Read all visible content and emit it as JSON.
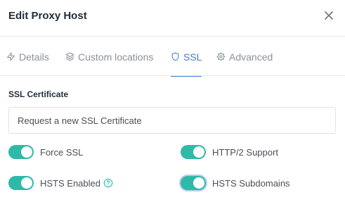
{
  "header": {
    "title": "Edit Proxy Host"
  },
  "tabs": [
    {
      "label": "Details",
      "icon": "zap-icon"
    },
    {
      "label": "Custom locations",
      "icon": "layers-icon"
    },
    {
      "label": "SSL",
      "icon": "shield-icon",
      "active": true
    },
    {
      "label": "Advanced",
      "icon": "gear-icon"
    }
  ],
  "ssl": {
    "section_label": "SSL Certificate",
    "certificate_value": "Request a new SSL Certificate",
    "toggles": [
      {
        "label": "Force SSL",
        "on": true
      },
      {
        "label": "HTTP/2 Support",
        "on": true
      },
      {
        "label": "HSTS Enabled",
        "on": true
      },
      {
        "label": "HSTS Subdomains",
        "on": true
      }
    ]
  },
  "colors": {
    "accent": "#467fcf",
    "toggle_on": "#2fb9a9",
    "muted_text": "#8a919b"
  }
}
